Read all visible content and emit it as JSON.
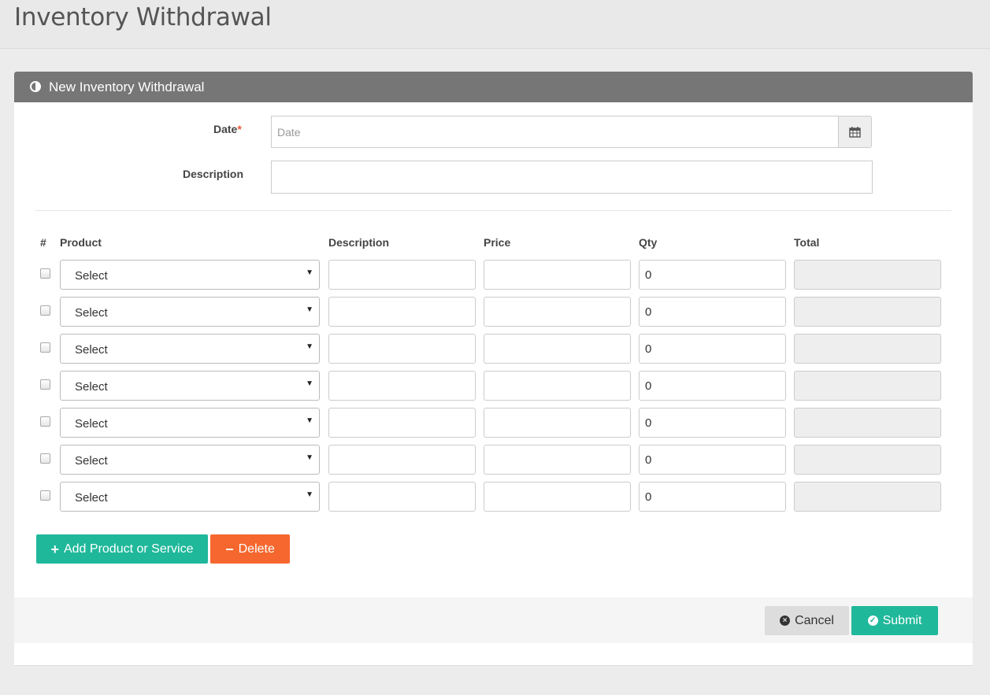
{
  "page": {
    "title": "Inventory Withdrawal"
  },
  "panel": {
    "title": "New Inventory Withdrawal"
  },
  "form": {
    "date_label": "Date",
    "required_marker": "*",
    "date_placeholder": "Date",
    "date_value": "",
    "description_label": "Description",
    "description_value": ""
  },
  "table": {
    "headers": {
      "index": "#",
      "product": "Product",
      "description": "Description",
      "price": "Price",
      "qty": "Qty",
      "total": "Total"
    },
    "rows": [
      {
        "product": "Select",
        "description": "",
        "price": "",
        "qty": "0",
        "total": ""
      },
      {
        "product": "Select",
        "description": "",
        "price": "",
        "qty": "0",
        "total": ""
      },
      {
        "product": "Select",
        "description": "",
        "price": "",
        "qty": "0",
        "total": ""
      },
      {
        "product": "Select",
        "description": "",
        "price": "",
        "qty": "0",
        "total": ""
      },
      {
        "product": "Select",
        "description": "",
        "price": "",
        "qty": "0",
        "total": ""
      },
      {
        "product": "Select",
        "description": "",
        "price": "",
        "qty": "0",
        "total": ""
      },
      {
        "product": "Select",
        "description": "",
        "price": "",
        "qty": "0",
        "total": ""
      }
    ]
  },
  "actions": {
    "add_label": "Add Product or Service",
    "delete_label": "Delete"
  },
  "footer": {
    "cancel_label": "Cancel",
    "submit_label": "Submit"
  },
  "icons": {
    "panel": "half-circle-icon",
    "date_addon": "calendar-icon",
    "add": "plus-icon",
    "delete": "minus-icon",
    "cancel": "times-circle-icon",
    "submit": "check-circle-icon",
    "select": "caret-down-icon"
  },
  "colors": {
    "panel_header": "#767676",
    "add_button": "#1fb89a",
    "delete_button": "#f5672e",
    "submit_button": "#1fb89a",
    "cancel_button": "#dddddd",
    "required": "#e55a3a"
  }
}
